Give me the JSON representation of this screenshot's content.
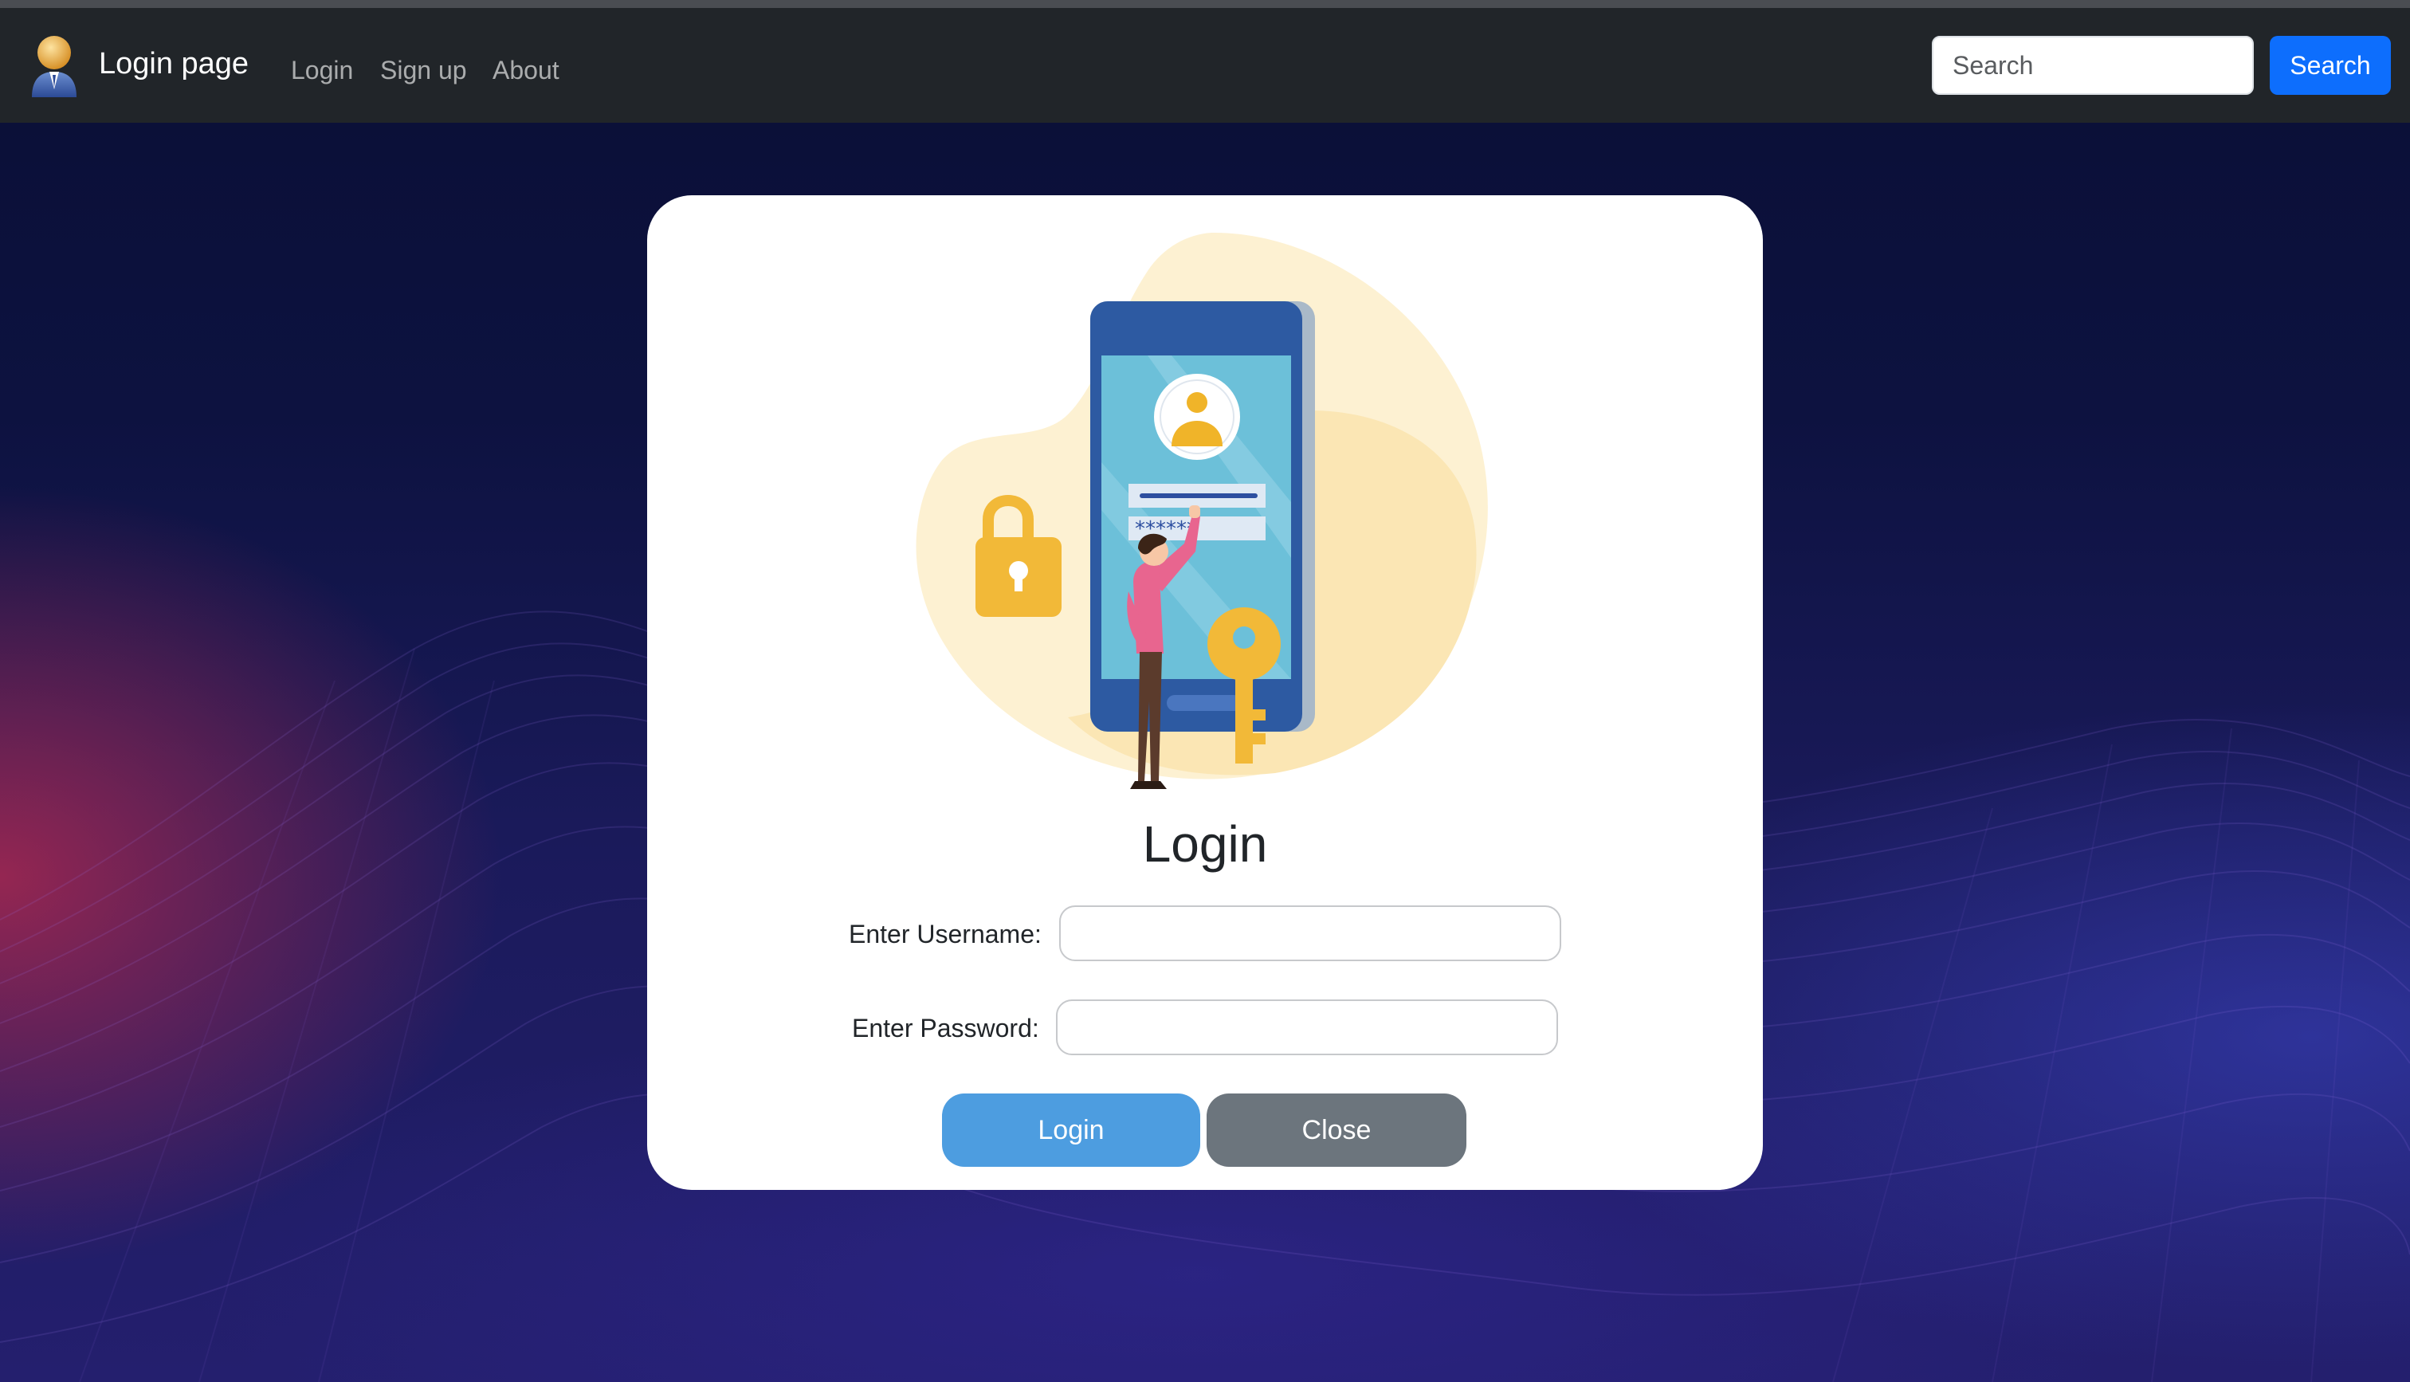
{
  "navbar": {
    "brand": "Login page",
    "links": [
      "Login",
      "Sign up",
      "About"
    ],
    "search": {
      "placeholder": "Search",
      "button_label": "Search"
    }
  },
  "login_card": {
    "title": "Login",
    "username_label": "Enter Username:",
    "password_label": "Enter Password:",
    "username_value": "",
    "password_value": "",
    "login_button": "Login",
    "close_button": "Close"
  },
  "colors": {
    "navbar": "#212529",
    "search_button": "#0d6efd",
    "login_button": "#4d9de0",
    "close_button": "#6c757d"
  }
}
